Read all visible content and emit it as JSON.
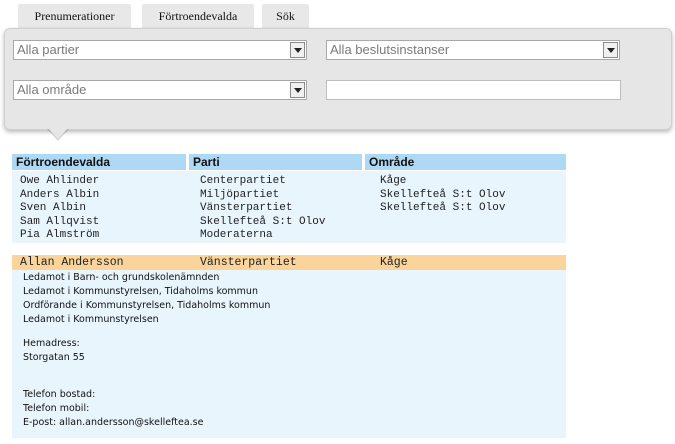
{
  "tabs": [
    {
      "label": "Prenumerationer"
    },
    {
      "label": "Förtroendevalda"
    },
    {
      "label": "Sök"
    }
  ],
  "filters": {
    "party_select": "Alla partier",
    "body_select": "Alla beslutsinstanser",
    "area_select": "Alla område",
    "search_value": ""
  },
  "columns": {
    "name": "Förtroendevalda",
    "party": "Parti",
    "area": "Område"
  },
  "list": {
    "names": [
      "Owe Ahlinder",
      "Anders Albin",
      "Sven Albin",
      "Sam Allqvist",
      "Pia Almström"
    ],
    "parties": [
      "Centerpartiet",
      "Miljöpartiet",
      "Vänsterpartiet",
      "Skellefteå S:t Olov",
      "Moderaterna"
    ],
    "areas": [
      "Kåge",
      "Skellefteå S:t Olov",
      "Skellefteå S:t Olov"
    ]
  },
  "selected": {
    "name": "Allan Andersson",
    "party": "Vänsterpartiet",
    "area": "Kåge"
  },
  "details": {
    "roles": [
      "Ledamot i Barn- och grundskolenämnden",
      "Ledamot i Kommunstyrelsen, Tidaholms kommun",
      "Ordförande i Kommunstyrelsen, Tidaholms kommun",
      "Ledamot i Kommunstyrelsen"
    ],
    "address_label": "Hemadress:",
    "address": "Storgatan 55",
    "phone_home": "Telefon bostad:",
    "phone_mobile": "Telefon mobil:",
    "email": "E-post: allan.andersson@skelleftea.se"
  },
  "colors": {
    "tab_bg": "#e8e8e8",
    "panel_bg": "#e6e6e6",
    "header_bg": "#aed9f5",
    "list_bg": "#e9f5fd",
    "selected_bg": "#fad49a"
  }
}
